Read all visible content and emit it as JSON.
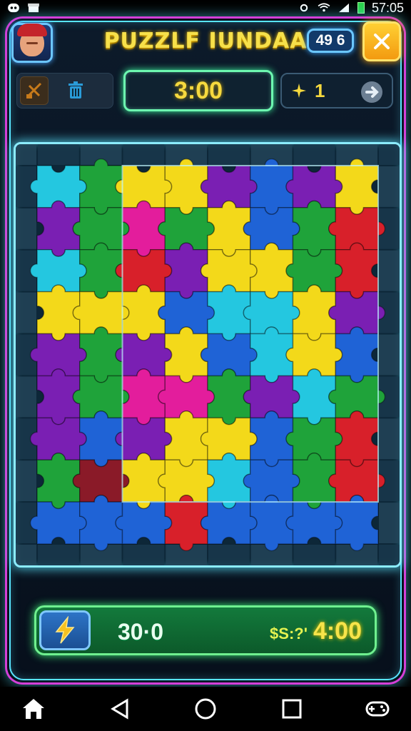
{
  "status_bar": {
    "time": "57:05",
    "icons": [
      "app-icon",
      "store-icon",
      "settings-icon",
      "wifi-icon",
      "signal-icon",
      "battery-icon"
    ]
  },
  "header": {
    "title": "PUZZLF IUNDAA",
    "score": "49 6",
    "close_icon": "close-icon",
    "avatar_icon": "player-avatar"
  },
  "toolbar": {
    "rotate_icon": "rotate-icon",
    "trash_icon": "trash-icon",
    "timer": "3:00",
    "hint_icon": "sparkle-icon",
    "hint_count": "1",
    "next_icon": "arrow-right-icon"
  },
  "board": {
    "rows": 9,
    "cols": 8,
    "palette": {
      "R": "#d8202a",
      "Y": "#f3d91a",
      "G": "#1fa33a",
      "B": "#1f63d6",
      "C": "#24c7e0",
      "P": "#7a1fb3",
      "M": "#e31d9c",
      "D": "#8a1a28"
    },
    "grid": [
      [
        "C",
        "G",
        "Y",
        "Y",
        "P",
        "B",
        "P",
        "Y"
      ],
      [
        "P",
        "G",
        "M",
        "G",
        "Y",
        "B",
        "G",
        "R"
      ],
      [
        "C",
        "G",
        "R",
        "P",
        "Y",
        "Y",
        "G",
        "R"
      ],
      [
        "Y",
        "Y",
        "Y",
        "B",
        "C",
        "C",
        "Y",
        "P"
      ],
      [
        "P",
        "G",
        "P",
        "Y",
        "B",
        "C",
        "Y",
        "B"
      ],
      [
        "P",
        "G",
        "M",
        "M",
        "G",
        "P",
        "C",
        "G"
      ],
      [
        "P",
        "B",
        "P",
        "Y",
        "Y",
        "B",
        "G",
        "R"
      ],
      [
        "G",
        "D",
        "Y",
        "Y",
        "C",
        "B",
        "G",
        "R"
      ],
      [
        "B",
        "B",
        "B",
        "R",
        "B",
        "B",
        "B",
        "B"
      ]
    ]
  },
  "bottom_bar": {
    "bolt_icon": "lightning-icon",
    "left_value": "30·0",
    "currency_label": "$S:?'",
    "right_value": "4:00"
  },
  "nav_bar": {
    "icons": [
      "home-icon",
      "back-icon",
      "home-circle-icon",
      "recents-icon",
      "game-controller-icon"
    ]
  }
}
